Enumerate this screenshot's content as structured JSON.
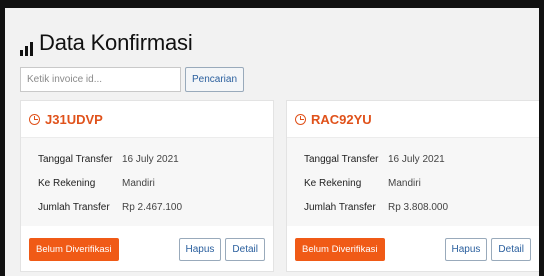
{
  "header": {
    "title": "Data Konfirmasi",
    "icon": "bar-chart-icon"
  },
  "search": {
    "placeholder": "Ketik invoice id...",
    "button_label": "Pencarian"
  },
  "labels": {
    "tanggal": "Tanggal Transfer",
    "rekening": "Ke Rekening",
    "jumlah": "Jumlah Transfer"
  },
  "colors": {
    "accent": "#e0521b",
    "status_button": "#f05a16",
    "link": "#2a5f9e"
  },
  "cards": [
    {
      "invoice_id": "J31UDVP",
      "tanggal": "16 July 2021",
      "rekening": "Mandiri",
      "jumlah": "Rp 2.467.100",
      "status_label": "Belum Diverifikasi",
      "delete_label": "Hapus",
      "detail_label": "Detail"
    },
    {
      "invoice_id": "RAC92YU",
      "tanggal": "16 July 2021",
      "rekening": "Mandiri",
      "jumlah": "Rp 3.808.000",
      "status_label": "Belum Diverifikasi",
      "delete_label": "Hapus",
      "detail_label": "Detail"
    }
  ]
}
